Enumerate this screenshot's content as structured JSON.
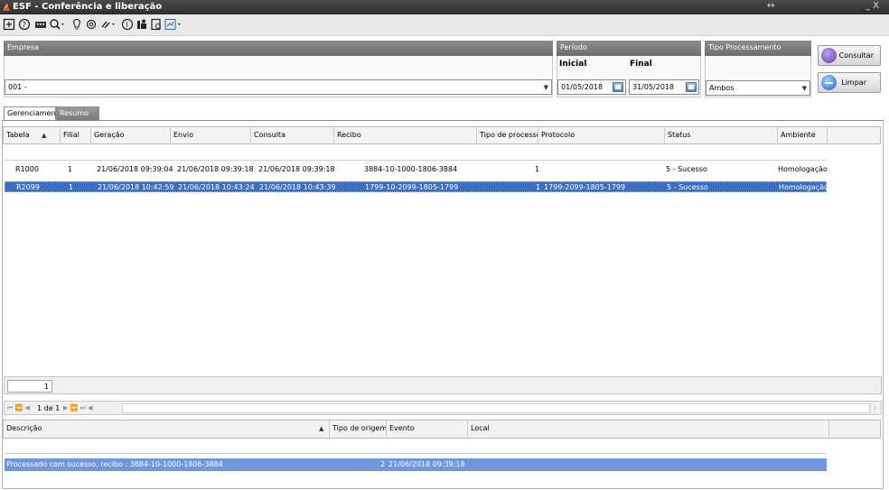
{
  "window": {
    "title": "ESF - Conferência e liberação",
    "restore_glyph": "↔",
    "min_close": "_ X"
  },
  "toolbar": {
    "icons": [
      "save-icon",
      "help-icon",
      "keyboard-icon",
      "search-icon",
      "lightbulb-icon",
      "settings-icon",
      "link-icon",
      "info-icon",
      "user-icon",
      "export-icon",
      "report-icon"
    ]
  },
  "filters": {
    "empresa_label": "Empresa",
    "empresa_value": "001 -",
    "periodo_label": "Período",
    "inicial_label": "Inicial",
    "final_label": "Final",
    "inicial_value": "01/05/2018",
    "final_value": "31/05/2018",
    "tipo_label": "Tipo Processamento",
    "tipo_value": "Ambos"
  },
  "buttons": {
    "consultar": "Consultar",
    "limpar": "Limpar"
  },
  "tabs": [
    "Gerenciamento",
    "Resumo"
  ],
  "grid": {
    "columns": [
      "Tabela",
      "Filial",
      "Geração",
      "Envio",
      "Consulta",
      "Recibo",
      "Tipo de processo",
      "Protocolo",
      "Status",
      "Ambiente"
    ],
    "rows": [
      [
        "R1000",
        "1",
        "21/06/2018 09:39:04",
        "21/06/2018 09:39:18",
        "21/06/2018 09:39:18",
        "3884-10-1000-1806-3884",
        "1",
        "",
        "5 - Sucesso",
        "Homologação"
      ],
      [
        "R2099",
        "1",
        "21/06/2018 10:42:59",
        "21/06/2018 10:43:24",
        "21/06/2018 10:43:39",
        "1799-10-2099-1805-1799",
        "1",
        "1799-2099-1805-1799",
        "5 - Sucesso",
        "Homologação"
      ]
    ],
    "selected_row": 1,
    "footer_count": "1",
    "pager_text": "1 de 1",
    "pager_nav_first": "⏮ ⏪ ◀",
    "pager_nav_last": "▶ ⏩ ⏭ ◀"
  },
  "detail": {
    "columns": [
      "Descrição",
      "Tipo de origem",
      "Evento",
      "Local"
    ],
    "rows": [
      [
        "Processado com sucesso, recibo : 3884-10-1000-1806-3884",
        "2",
        "21/06/2018 09:39:18",
        ""
      ]
    ]
  },
  "colors": {
    "accent": "#3b6fc4",
    "header_gray": "#7a7a7a",
    "title_bar": "#3a3a3a",
    "app_icon": "#e8562a"
  }
}
